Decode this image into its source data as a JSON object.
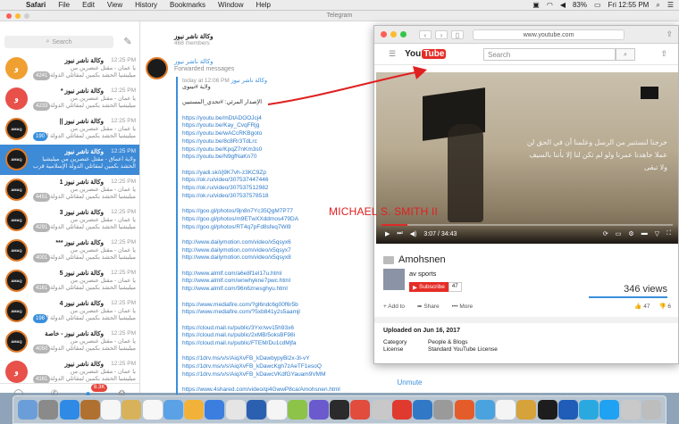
{
  "menubar": {
    "app": "Safari",
    "items": [
      "File",
      "Edit",
      "View",
      "History",
      "Bookmarks",
      "Window",
      "Help"
    ],
    "battery": "83%",
    "clock": "Fri 12:55 PM"
  },
  "telegram": {
    "window_title": "Telegram",
    "search_placeholder": "Search",
    "chats": [
      {
        "name": "وكالة ناشر نيوز",
        "time": "12:25 PM",
        "prev1": "يا عمان - مقتل عنصرين من",
        "prev2": "ميليشيا الحشد بكمين لمقاتلي الدولة الإ",
        "badge": "4241",
        "avatar": "و",
        "avatar_color": "#f0a030",
        "dark": false
      },
      {
        "name": "وكالة ناشر نيوز *",
        "time": "12:25 PM",
        "prev1": "يا عمان - مقتل عنصرين من",
        "prev2": "ميليشيا الحشد بكمين لمقاتلي الدولة الإ",
        "badge": "4233",
        "avatar": "و",
        "avatar_color": "#e8504a",
        "dark": false
      },
      {
        "name": "وكالة ناشر نيوز ||",
        "time": "12:25 PM",
        "prev1": "يا عمان - مقتل عنصرين من",
        "prev2": "ميليشيا الحشد بكمين لمقاتلي الدولة الإ",
        "badge": "190",
        "avatar": "AMAQ",
        "avatar_color": "#1b1b1b",
        "dark": true,
        "blue": true
      },
      {
        "name": "وكالة ناشر نيوز",
        "time": "12:25 PM",
        "prev1": "ولاية أعماق - مقتل عنصرين من ميليشيا",
        "prev2": "الحشد بكمين لمقاتلي الدولة الإسلامية قرب قرية",
        "badge": "",
        "avatar": "AMAQ",
        "avatar_color": "#1b1b1b",
        "dark": true,
        "active": true
      },
      {
        "name": "وكالة ناشر نيوز 1",
        "time": "12:25 PM",
        "prev1": "يا عمان - مقتل عنصرين من",
        "prev2": "ميليشيا الحشد بكمين لمقاتلي الدولة الإ",
        "badge": "4451",
        "avatar": "AMAQ",
        "avatar_color": "#1b1b1b",
        "dark": true
      },
      {
        "name": "وكالة ناشر نيوز 3",
        "time": "12:25 PM",
        "prev1": "يا عمان - مقتل عنصرين من",
        "prev2": "ميليشيا الحشد بكمين لمقاتلي الدولة الإ",
        "badge": "4291",
        "avatar": "AMAQ",
        "avatar_color": "#1b1b1b",
        "dark": true
      },
      {
        "name": "وكالة ناشر نيوز ***",
        "time": "12:25 PM",
        "prev1": "يا عمان - مقتل عنصرين من",
        "prev2": "ميليشيا الحشد بكمين لمقاتلي الدولة الإ",
        "badge": "4001",
        "avatar": "AMAQ",
        "avatar_color": "#1b1b1b",
        "dark": true
      },
      {
        "name": "وكالة ناشر نيوز 5",
        "time": "12:25 PM",
        "prev1": "يا عمان - مقتل عنصرين من",
        "prev2": "ميليشيا الحشد بكمين لمقاتلي الدولة الإ",
        "badge": "4161",
        "avatar": "AMAQ",
        "avatar_color": "#1b1b1b",
        "dark": true
      },
      {
        "name": "وكالة ناشر نيوز 4",
        "time": "12:25 PM",
        "prev1": "يا عمان - مقتل عنصرين من",
        "prev2": "ميليشيا الحشد بكمين لمقاتلي الدولة الإ",
        "badge": "198",
        "avatar": "AMAQ",
        "avatar_color": "#1b1b1b",
        "dark": true,
        "blue": true
      },
      {
        "name": "وكالة ناشر نيوز - خاصة",
        "time": "12:25 PM",
        "prev1": "يا عمان - مقتل عنصرين من",
        "prev2": "ميليشيا الحشد بكمين لمقاتلي الدولة الإ",
        "badge": "4050",
        "avatar": "AMAQ",
        "avatar_color": "#1b1b1b",
        "dark": true
      },
      {
        "name": "وكالة ناشر نيوز",
        "time": "12:25 PM",
        "prev1": "يا عمان - مقتل عنصرين من",
        "prev2": "ميليشيا الحشد بكمين لمقاتلي الدولة الإ",
        "badge": "4161",
        "avatar": "و",
        "avatar_color": "#e8504a",
        "dark": false
      }
    ],
    "footer_badge": "8.3K",
    "chat_name": "وكالة ناشر نيوز",
    "chat_members": "468 members",
    "fwd_name": "وكالة ناشر نيوز",
    "fwd_label": "Forwarded messages",
    "msg_meta_time": "today at 12:06 PM",
    "msg_meta_from": "وكالة ناشر نيوز",
    "msg_line1": "ولاية #نينوى",
    "msg_line2": "الإصدار المرئي: #تحدي_المستبين",
    "links": [
      "https://youtu.be/mDtADOOJcj4",
      "https://youtu.be/Kay_CvqFRjg",
      "https://youtu.be/wACcRKBgoto",
      "https://youtu.be/8c8Rr3TdLrc",
      "https://youtu.be/KpqZ7nKm3s0",
      "https://youtu.be/N9gfNaKn70",
      "",
      "https://yadi.sk/i/j9K7vh-z3KC9Zp",
      "https://ok.ru/video/307537447446",
      "https://ok.ru/video/307537512982",
      "https://ok.ru/video/307537578518",
      "",
      "https://goo.gl/photos/9jn8n7Yc35QgM7P77",
      "https://goo.gl/photos/m9ETwXXddmos479DA",
      "https://goo.gl/photos/RT4q7pFd8sfeq7Wi9",
      "",
      "http://www.dailymotion.com/video/x5qsyx6",
      "http://www.dailymotion.com/video/x5qsyx7",
      "http://www.dailymotion.com/video/x5qsyx8",
      "",
      "http://www.almlf.com/a6e8f1el17u.html",
      "http://www.almlf.com/wnwhykne7pwc.html",
      "http://www.almlf.com/96n6znesghyu.html",
      "",
      "https://www.mediafire.com/?gl6ndc6g00f6r5b",
      "https://www.mediafire.com/?5xb841y2s5aamjl",
      "",
      "https://cloud.mail.ru/public/3Yxr/wv15h93x6",
      "https://cloud.mail.ru/public/2xMB/5oksBF98i",
      "https://cloud.mail.ru/public/FTEM/Du1cdMjfa",
      "",
      "https://1drv.ms/v/s!AiqXvFB_kDawbypyBi2x-3l-vY",
      "https://1drv.ms/v/s!AiqXvFB_kDawcKgh7zAeTF1esoQ",
      "https://1drv.ms/v/s!AiqXvFB_kDawcVKdfGYauam9VMM",
      "",
      "https://www.4shared.com/video/qi4GwwP8ca/Amohsnen.html"
    ],
    "unmute": "Unmute"
  },
  "safari": {
    "url": "www.youtube.com",
    "yt_logo_you": "You",
    "yt_logo_tube": "Tube",
    "search_placeholder": "Search",
    "time": "3:07 / 34:43",
    "title": "Amohsnen",
    "channel": "av sports",
    "subscribe": "Subscribe",
    "sub_count": "47",
    "views": "346 views",
    "add_to": "Add to",
    "share": "Share",
    "more": "More",
    "likes": "47",
    "dislikes": "6",
    "uploaded": "Uploaded on Jun 16, 2017",
    "category_label": "Category",
    "category_value": "People & Blogs",
    "license_label": "License",
    "license_value": "Standard YouTube License",
    "progress": 0.09,
    "video_text": "خرجنا لنستنير من الرسل وعلمنا أن في الحق لن عملا جاهدنا عمرنا ولو لم تكن لنا إلا بأننا بالسيف ولا تبقى"
  },
  "watermark": "MICHAEL S. SMITH II",
  "colors": {
    "accent": "#3a8fdc",
    "youtube_red": "#e52d27",
    "arrow": "#e02020"
  }
}
